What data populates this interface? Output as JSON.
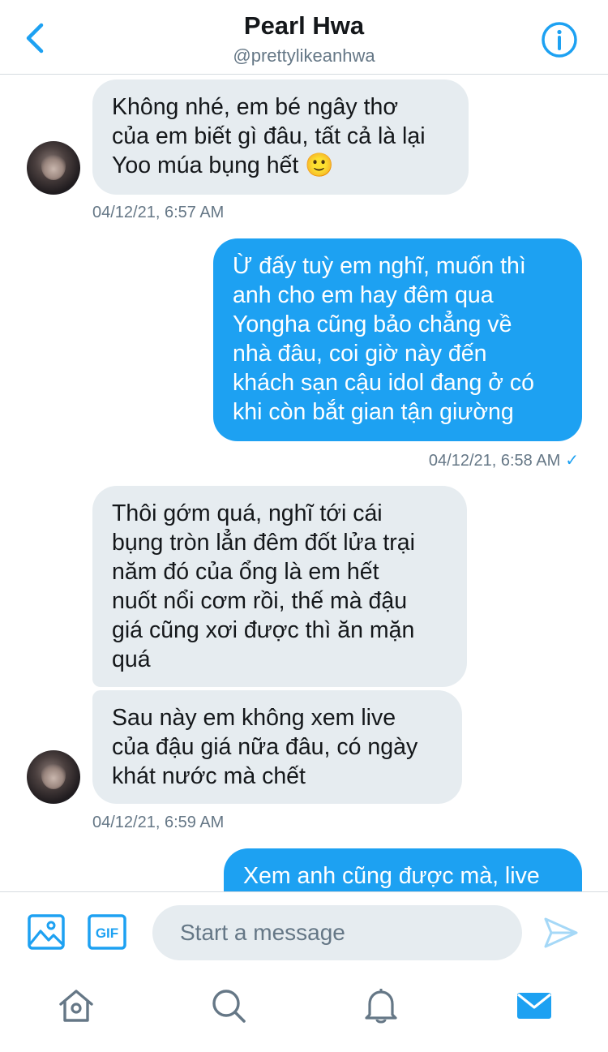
{
  "header": {
    "name": "Pearl Hwa",
    "handle": "@prettylikeanhwa"
  },
  "messages": {
    "m1": {
      "lines": [
        "Không nhé, em bé ngây thơ",
        "của em biết gì đâu, tất cả là lại",
        "Yoo múa bụng hết 🙂"
      ],
      "timestamp": "04/12/21, 6:57 AM"
    },
    "m2": {
      "lines": [
        "Ừ đấy tuỳ em nghĩ, muốn thì",
        "anh cho em hay đêm qua",
        "Yongha cũng bảo chẳng về",
        "nhà đâu, coi giờ này đến",
        "khách sạn cậu idol đang ở có",
        "khi còn bắt gian tận giường"
      ],
      "timestamp": "04/12/21, 6:58 AM",
      "status_mark": "✓"
    },
    "m3": {
      "lines": [
        "Thôi gớm quá, nghĩ tới cái",
        "bụng tròn lẳn đêm đốt lửa trại",
        "năm đó của ổng là em hết",
        "nuốt nổi cơm rồi, thế mà đậu",
        "giá cũng xơi được thì ăn mặn",
        "quá"
      ]
    },
    "m4": {
      "lines": [
        "Sau này em không xem live",
        "của đậu giá nữa đâu, có ngày",
        "khát nước mà chết"
      ],
      "timestamp": "04/12/21, 6:59 AM"
    },
    "m5": {
      "lines": [
        "Xem anh cũng được mà, live"
      ]
    }
  },
  "composer": {
    "gif_label": "GIF",
    "placeholder": "Start a message"
  },
  "icons": {
    "back": "chevron-left-icon",
    "info": "info-icon",
    "image": "image-icon",
    "gif": "gif-icon",
    "send": "send-icon",
    "home": "home-icon",
    "search": "search-icon",
    "notifications": "bell-icon",
    "messages": "mail-icon"
  },
  "colors": {
    "accent": "#1da1f2",
    "incoming_bubble": "#e6ecf0",
    "muted_text": "#657786"
  }
}
